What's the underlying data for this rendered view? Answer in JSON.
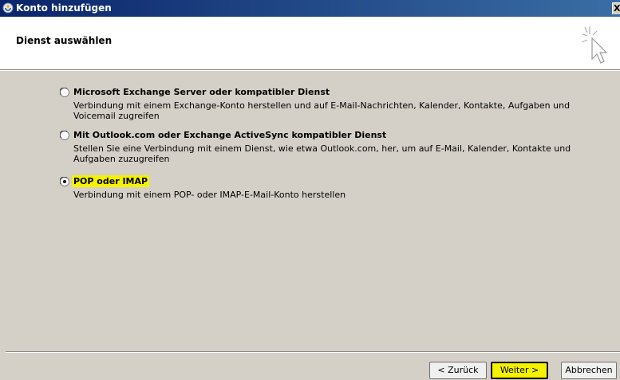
{
  "window": {
    "title": "Konto hinzufügen",
    "close_glyph": "X"
  },
  "header": {
    "heading": "Dienst auswählen"
  },
  "options": [
    {
      "title": "Microsoft Exchange Server oder kompatibler Dienst",
      "description": "Verbindung mit einem Exchange-Konto herstellen und auf E-Mail-Nachrichten, Kalender, Kontakte, Aufgaben und Voicemail zugreifen",
      "selected": false
    },
    {
      "title": "Mit Outlook.com oder Exchange ActiveSync kompatibler Dienst",
      "description": "Stellen Sie eine Verbindung mit einem Dienst, wie etwa Outlook.com, her, um auf E-Mail, Kalender, Kontakte und Aufgaben zuzugreifen",
      "selected": false
    },
    {
      "title": "POP oder IMAP",
      "description": "Verbindung mit einem POP- oder IMAP-E-Mail-Konto herstellen",
      "selected": true
    }
  ],
  "buttons": {
    "back": "< Zurück",
    "next": "Weiter >",
    "cancel": "Abbrechen"
  },
  "colors": {
    "highlight": "#f5f200",
    "titlebar": "#0a246a",
    "dialog_bg": "#d4d0c8"
  }
}
